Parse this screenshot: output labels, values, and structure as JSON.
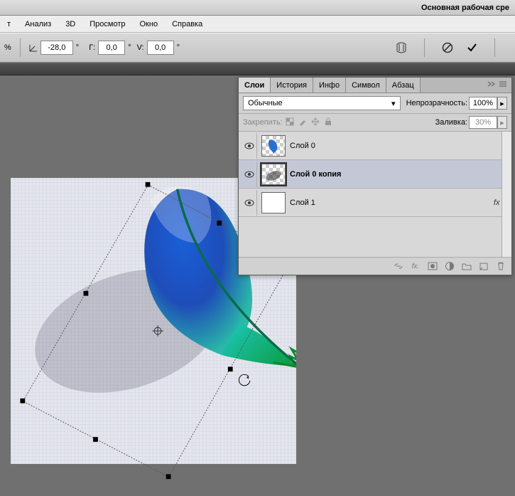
{
  "title_bar": {
    "workspace": "Основная рабочая сре"
  },
  "menu": {
    "items": [
      "т",
      "Анализ",
      "3D",
      "Просмотр",
      "Окно",
      "Справка"
    ]
  },
  "options": {
    "pct_suffix": "%",
    "angle_icon": "∠",
    "angle_value": "-28,0",
    "deg": "°",
    "h_label": "Г:",
    "h_value": "0,0",
    "v_label": "V:",
    "v_value": "0,0"
  },
  "panel": {
    "tabs": [
      "Слои",
      "История",
      "Инфо",
      "Символ",
      "Абзац"
    ],
    "active_tab": 0,
    "blend_mode": "Обычные",
    "opacity_label": "Непрозрачность:",
    "opacity_value": "100%",
    "lock_label": "Закрепить:",
    "fill_label": "Заливка:",
    "fill_value": "30%",
    "layers": [
      {
        "name": "Слой 0",
        "visible": true,
        "thumb": "checker-feather",
        "selected": false,
        "fx": false
      },
      {
        "name": "Слой 0 копия",
        "visible": true,
        "thumb": "checker-shadow",
        "selected": true,
        "fx": false,
        "bold": true
      },
      {
        "name": "Слой 1",
        "visible": true,
        "thumb": "white",
        "selected": false,
        "fx": true
      }
    ],
    "fx_label": "fx"
  }
}
